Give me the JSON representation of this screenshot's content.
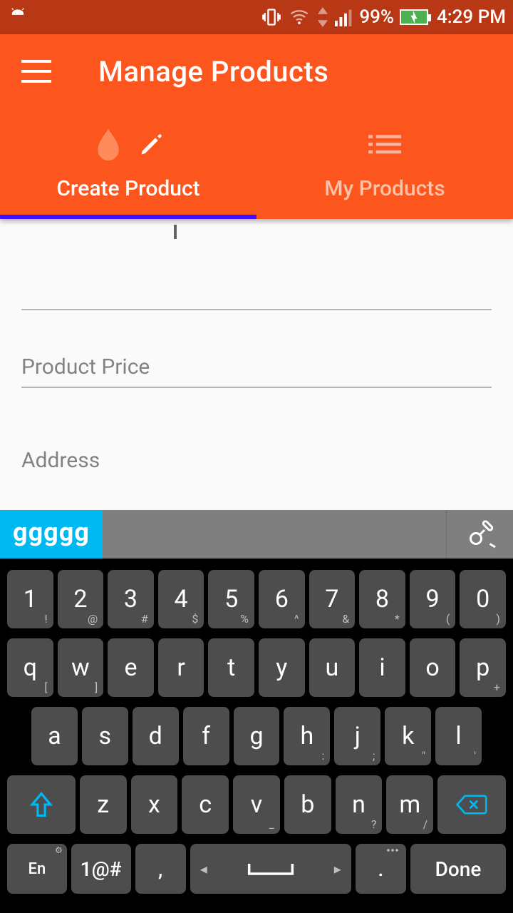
{
  "status": {
    "battery_pct": "99%",
    "time": "4:29 PM"
  },
  "header": {
    "title": "Manage Products"
  },
  "tabs": {
    "create": "Create Product",
    "my": "My Products"
  },
  "fields": {
    "price": "Product Price",
    "address": "Address"
  },
  "suggestion": {
    "word": "ggggg"
  },
  "keyboard": {
    "row1": [
      {
        "k": "1",
        "s": "!"
      },
      {
        "k": "2",
        "s": "@"
      },
      {
        "k": "3",
        "s": "#"
      },
      {
        "k": "4",
        "s": "$"
      },
      {
        "k": "5",
        "s": "%"
      },
      {
        "k": "6",
        "s": "^"
      },
      {
        "k": "7",
        "s": "&"
      },
      {
        "k": "8",
        "s": "*"
      },
      {
        "k": "9",
        "s": "("
      },
      {
        "k": "0",
        "s": ")"
      }
    ],
    "row2": [
      {
        "k": "q",
        "s": "["
      },
      {
        "k": "w",
        "s": "]"
      },
      {
        "k": "e",
        "s": ""
      },
      {
        "k": "r",
        "s": ""
      },
      {
        "k": "t",
        "s": ""
      },
      {
        "k": "y",
        "s": ""
      },
      {
        "k": "u",
        "s": ""
      },
      {
        "k": "i",
        "s": ""
      },
      {
        "k": "o",
        "s": ""
      },
      {
        "k": "p",
        "s": "+"
      }
    ],
    "row3": [
      {
        "k": "a",
        "s": ""
      },
      {
        "k": "s",
        "s": ""
      },
      {
        "k": "d",
        "s": ""
      },
      {
        "k": "f",
        "s": ""
      },
      {
        "k": "g",
        "s": ""
      },
      {
        "k": "h",
        "s": ":"
      },
      {
        "k": "j",
        "s": ";"
      },
      {
        "k": "k",
        "s": "\""
      },
      {
        "k": "l",
        "s": "'"
      }
    ],
    "row4": [
      {
        "k": "z",
        "s": ""
      },
      {
        "k": "x",
        "s": ""
      },
      {
        "k": "c",
        "s": ""
      },
      {
        "k": "v",
        "s": "_"
      },
      {
        "k": "b",
        "s": ""
      },
      {
        "k": "n",
        "s": "?"
      },
      {
        "k": "m",
        "s": "/"
      }
    ],
    "bottom": {
      "lang": "En",
      "sym": "1@#",
      "comma": ",",
      "period": ".",
      "done": "Done"
    }
  }
}
